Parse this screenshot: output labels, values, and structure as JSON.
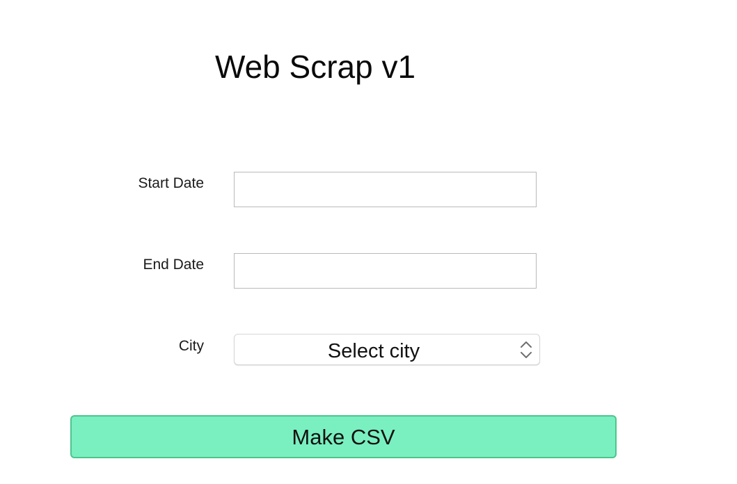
{
  "app": {
    "title": "Web Scrap v1"
  },
  "form": {
    "start_date": {
      "label": "Start Date",
      "value": ""
    },
    "end_date": {
      "label": "End Date",
      "value": ""
    },
    "city": {
      "label": "City",
      "selected": "Select city",
      "icon": "updown-chevron-icon"
    }
  },
  "actions": {
    "make_csv_label": "Make CSV"
  },
  "colors": {
    "button_fill": "#7af0c1",
    "button_border": "#4cc58c",
    "field_border": "#b9b9b9"
  }
}
